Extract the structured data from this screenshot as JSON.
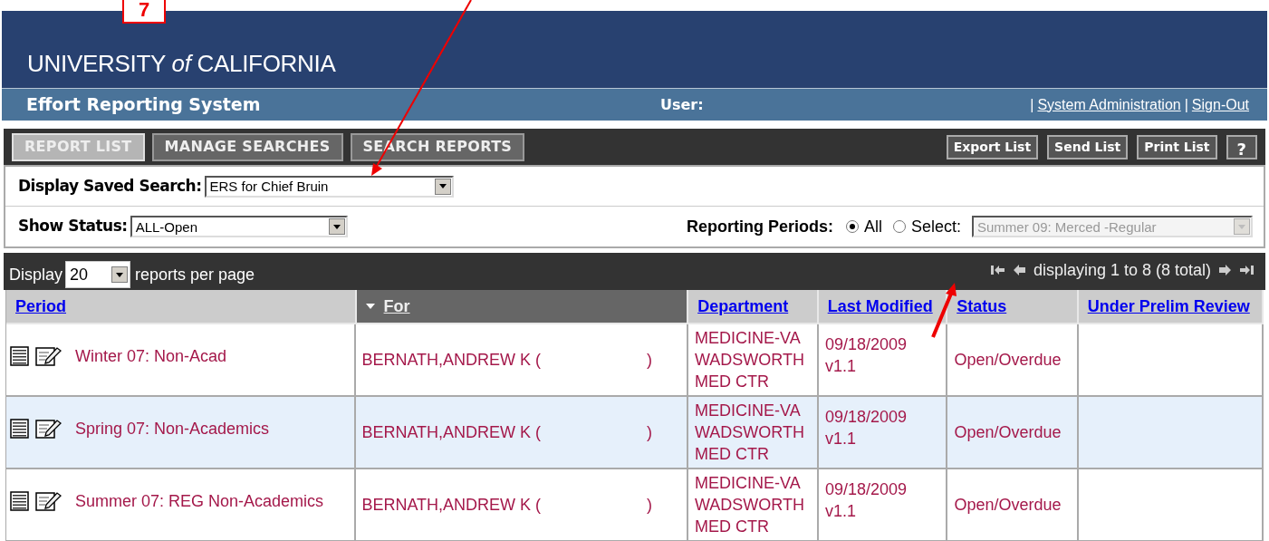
{
  "header": {
    "logo": "UNIVERSITY *of* CALIFORNIA",
    "app_title": "Effort Reporting System",
    "user_label": "User:",
    "links": [
      {
        "separator": "|",
        "label": "System Administration"
      },
      {
        "separator": "|",
        "label": "Sign-Out"
      }
    ]
  },
  "tabs": [
    {
      "label": "REPORT LIST",
      "selected": true
    },
    {
      "label": "MANAGE SEARCHES",
      "selected": false
    },
    {
      "label": "SEARCH REPORTS",
      "selected": false
    }
  ],
  "toolbar_buttons": [
    "Export List",
    "Send List",
    "Print List",
    "?"
  ],
  "filters": {
    "saved_search": {
      "label": "Display Saved Search:",
      "value": "ERS for Chief Bruin"
    },
    "show_status": {
      "label": "Show Status:",
      "value": "ALL-Open"
    },
    "reporting_periods": {
      "label": "Reporting Periods:",
      "options": [
        {
          "label": "All",
          "selected": true
        },
        {
          "label": "Select:",
          "selected": false
        }
      ],
      "period_select": {
        "value": "Summer 09: Merced -Regular",
        "disabled": true
      }
    }
  },
  "pager": {
    "display_label": "Display",
    "page_size": "20",
    "suffix": "reports per page",
    "summary": "displaying 1 to 8 (8 total)"
  },
  "table": {
    "columns": [
      {
        "label": "Period",
        "sorted": false
      },
      {
        "label": "For",
        "sorted": true
      },
      {
        "label": "Department",
        "sorted": false
      },
      {
        "label": "Last Modified",
        "sorted": false
      },
      {
        "label": "Status",
        "sorted": false
      },
      {
        "label": "Under Prelim Review",
        "sorted": false
      }
    ],
    "rows": [
      {
        "period": "Winter 07: Non-Acad",
        "for": "BERNATH,ANDREW K (",
        "for_close": ")",
        "department": "MEDICINE-VA WADSWORTH MED CTR",
        "last_modified": "09/18/2009",
        "version": "v1.1",
        "status": "Open/Overdue"
      },
      {
        "period": "Spring 07: Non-Academics",
        "for": "BERNATH,ANDREW K (",
        "for_close": ")",
        "department": "MEDICINE-VA WADSWORTH MED CTR",
        "last_modified": "09/18/2009",
        "version": "v1.1",
        "status": "Open/Overdue"
      },
      {
        "period": "Summer 07: REG Non-Academics",
        "for": "BERNATH,ANDREW K (",
        "for_close": ")",
        "department": "MEDICINE-VA WADSWORTH MED CTR",
        "last_modified": "09/18/2009",
        "version": "v1.1",
        "status": "Open/Overdue"
      }
    ]
  },
  "annotation": {
    "label": "7"
  }
}
